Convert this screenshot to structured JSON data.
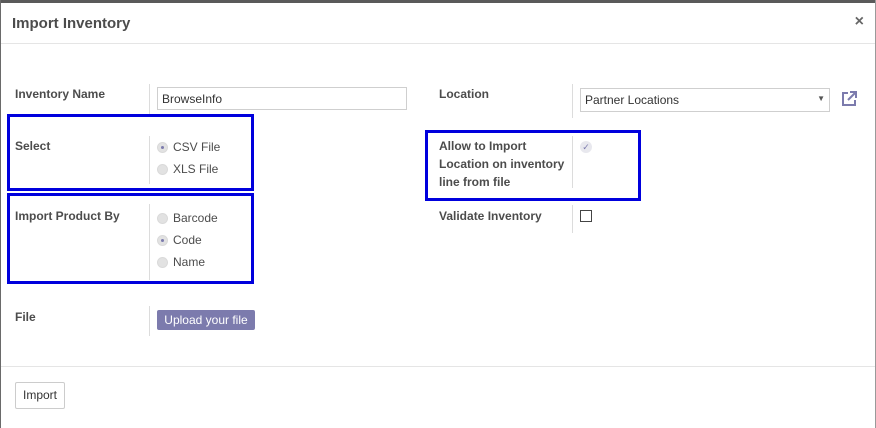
{
  "dialog": {
    "title": "Import Inventory",
    "close_glyph": "×"
  },
  "form": {
    "inventory_name": {
      "label": "Inventory Name",
      "value": "BrowseInfo"
    },
    "select": {
      "label": "Select",
      "options": [
        {
          "label": "CSV File",
          "checked": true
        },
        {
          "label": "XLS File",
          "checked": false
        }
      ]
    },
    "import_product_by": {
      "label": "Import Product By",
      "options": [
        {
          "label": "Barcode",
          "checked": false
        },
        {
          "label": "Code",
          "checked": true
        },
        {
          "label": "Name",
          "checked": false
        }
      ]
    },
    "file": {
      "label": "File",
      "upload_label": "Upload your file"
    },
    "location": {
      "label": "Location",
      "value": "Partner Locations",
      "external_link_icon": "external-link-icon"
    },
    "allow_import_location": {
      "label_lines": [
        "Allow to Import",
        "Location on inventory",
        "line from file"
      ],
      "checked": true
    },
    "validate_inventory": {
      "label": "Validate Inventory",
      "checked": false
    }
  },
  "footer": {
    "import_label": "Import"
  },
  "colors": {
    "accent": "#7c7bad",
    "highlight_box": "#0000dd",
    "title_text": "#4c4c4c"
  }
}
